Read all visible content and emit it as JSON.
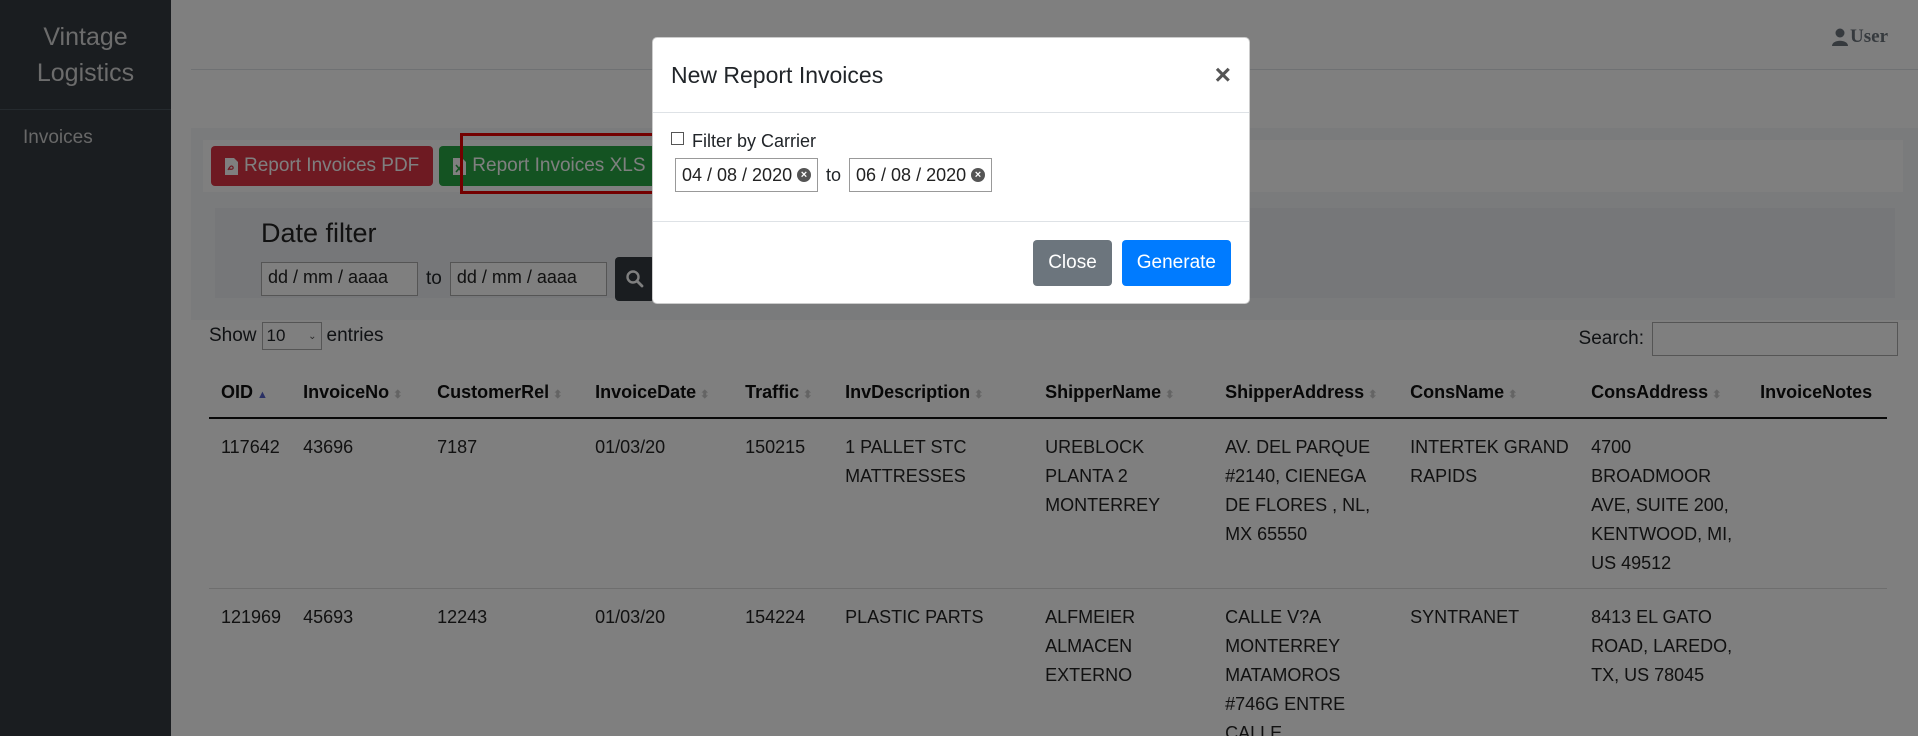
{
  "sidebar": {
    "brand_line1": "Vintage",
    "brand_line2": "Logistics",
    "nav_invoices": "Invoices"
  },
  "topbar": {
    "user_label": "User"
  },
  "toolbar": {
    "pdf_label": "Report Invoices PDF",
    "xls_label": "Report Invoices XLS"
  },
  "date_filter": {
    "title": "Date filter",
    "from_placeholder": "dd / mm / aaaa",
    "to_label": "to",
    "to_placeholder": "dd / mm / aaaa"
  },
  "datatable": {
    "show_label": "Show",
    "entries_value": "10",
    "entries_label": "entries",
    "search_label": "Search:",
    "columns": [
      "OID",
      "InvoiceNo",
      "CustomerRel",
      "InvoiceDate",
      "Traffic",
      "InvDescription",
      "ShipperName",
      "ShipperAddress",
      "ConsName",
      "ConsAddress",
      "InvoiceNotes"
    ],
    "rows": [
      [
        "117642",
        "43696",
        "7187",
        "01/03/20",
        "150215",
        "1 PALLET STC MATTRESSES",
        "UREBLOCK PLANTA 2 MONTERREY",
        "AV. DEL PARQUE #2140, CIENEGA DE FLORES , NL, MX 65550",
        "INTERTEK GRAND RAPIDS",
        "4700 BROADMOOR AVE, SUITE 200, KENTWOOD, MI, US 49512",
        ""
      ],
      [
        "121969",
        "45693",
        "12243",
        "01/03/20",
        "154224",
        "PLASTIC PARTS",
        "ALFMEIER ALMACEN EXTERNO",
        "CALLE V?A MONTERREY MATAMOROS #746G ENTRE CALLE",
        "SYNTRANET",
        "8413 EL GATO ROAD, LAREDO, TX, US 78045",
        ""
      ]
    ]
  },
  "modal": {
    "title": "New Report Invoices",
    "close_symbol": "×",
    "filter_by_carrier": "Filter by Carrier",
    "from_date": "04 / 08 / 2020",
    "to_label": "to",
    "to_date": "06 / 08 / 2020",
    "close_label": "Close",
    "generate_label": "Generate"
  }
}
